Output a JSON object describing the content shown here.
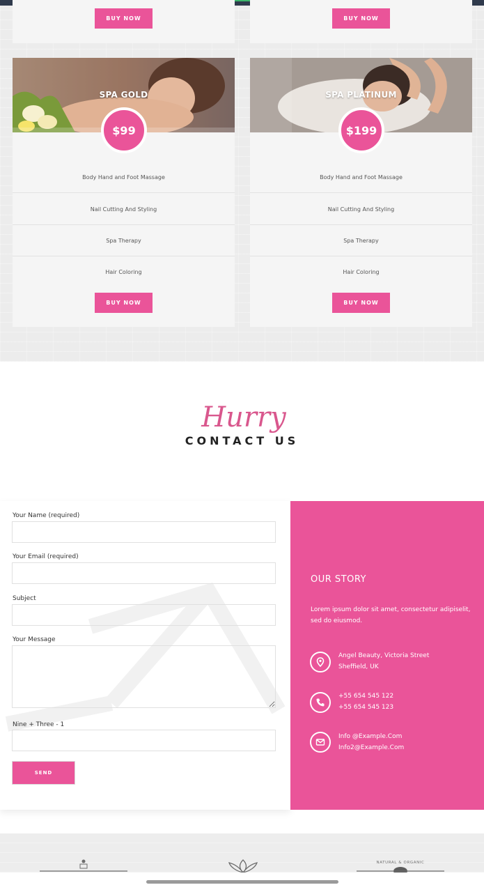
{
  "pricing": {
    "top_cards": [
      {
        "button": "BUY NOW"
      },
      {
        "button": "BUY NOW"
      }
    ],
    "cards": [
      {
        "title": "SPA GOLD",
        "price": "$99",
        "features": [
          "Body Hand and Foot Massage",
          "Nail Cutting And Styling",
          "Spa Therapy",
          "Hair Coloring"
        ],
        "button": "BUY NOW"
      },
      {
        "title": "SPA PLATINUM",
        "price": "$199",
        "features": [
          "Body Hand and Foot Massage",
          "Nail Cutting And Styling",
          "Spa Therapy",
          "Hair Coloring"
        ],
        "button": "BUY NOW"
      }
    ]
  },
  "contact": {
    "script_word": "Hurry",
    "title": "CONTACT US"
  },
  "form": {
    "name_label": "Your Name (required)",
    "email_label": "Your Email (required)",
    "subject_label": "Subject",
    "message_label": "Your Message",
    "captcha_label": "Nine + Three - 1",
    "send_label": "SEND"
  },
  "story": {
    "heading": "OUR STORY",
    "text": "Lorem ipsum dolor sit amet, consectetur adipiselit, sed do eiusmod.",
    "address_line1": "Angel Beauty, Victoria Street",
    "address_line2": "Sheffield, UK",
    "phone1": "+55 654 545 122",
    "phone2": "+55 654 545 123",
    "email1": "Info @Example.Com",
    "email2": "Info2@Example.Com"
  },
  "logos": {
    "badge_text": "NATURAL & ORGANIC"
  },
  "colors": {
    "accent": "#ea5499",
    "card_bg": "#f5f5f5",
    "page_bg": "#ececec"
  },
  "icons": [
    "map-pin-icon",
    "phone-icon",
    "envelope-icon"
  ]
}
